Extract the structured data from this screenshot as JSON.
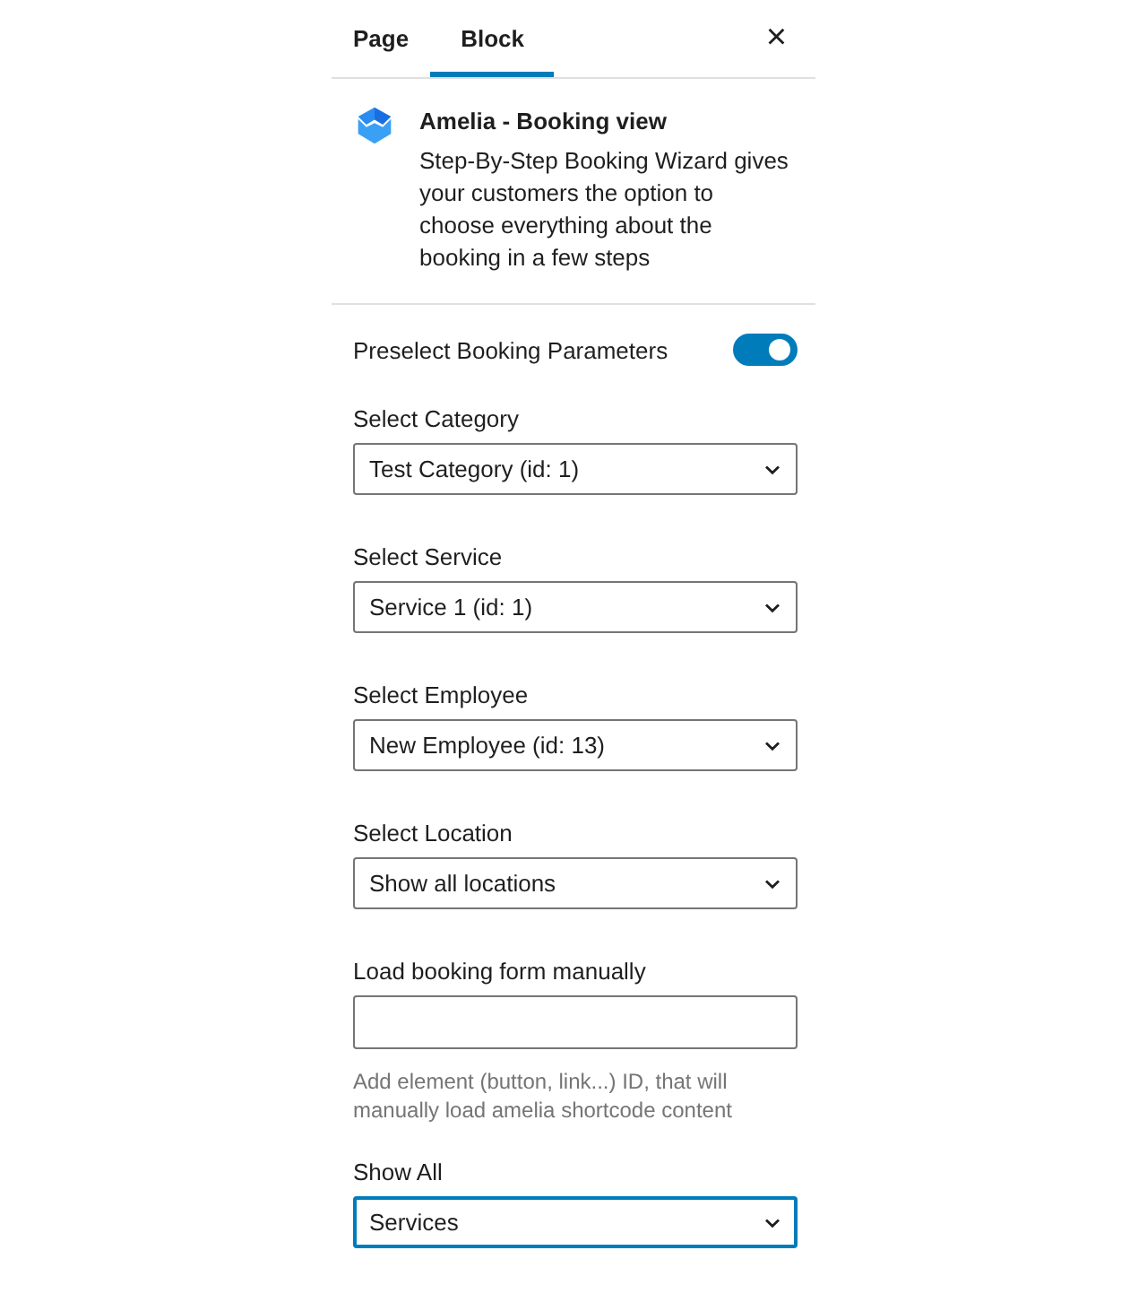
{
  "tabs": [
    {
      "label": "Page",
      "selected": false
    },
    {
      "label": "Block",
      "selected": true
    }
  ],
  "close": "×",
  "block": {
    "title": "Amelia - Booking view",
    "description": "Step-By-Step Booking Wizard gives your customers the option to choose everything about the booking in a few steps"
  },
  "toggle": {
    "label": "Preselect Booking Parameters",
    "on": true
  },
  "fields": [
    {
      "kind": "select",
      "label": "Select Category",
      "value": "Test Category (id: 1)",
      "focused": false
    },
    {
      "kind": "select",
      "label": "Select Service",
      "value": "Service 1 (id: 1)",
      "focused": false
    },
    {
      "kind": "select",
      "label": "Select Employee",
      "value": "New Employee (id: 13)",
      "focused": false
    },
    {
      "kind": "select",
      "label": "Select Location",
      "value": "Show all locations",
      "focused": false
    },
    {
      "kind": "text",
      "label": "Load booking form manually",
      "help": "Add element (button, link...) ID, that will manually load amelia shortcode content"
    },
    {
      "kind": "select",
      "label": "Show All",
      "value": "Services",
      "focused": true
    }
  ]
}
